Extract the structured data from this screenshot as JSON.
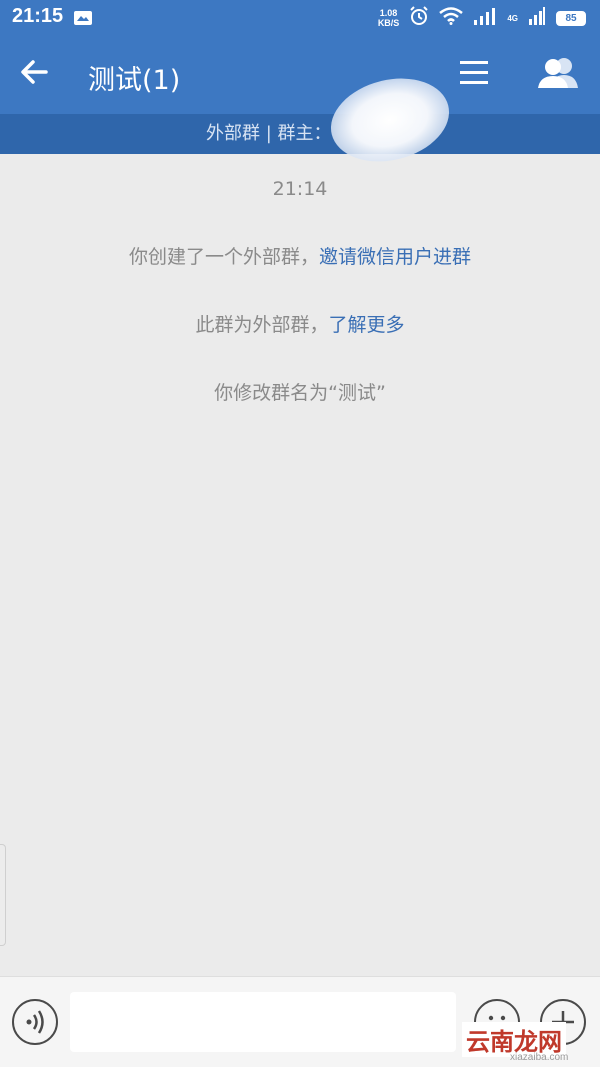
{
  "status_bar": {
    "time": "21:15",
    "net_speed_value": "1.08",
    "net_speed_unit": "KB/S",
    "network_type": "4G",
    "battery": "85"
  },
  "header": {
    "title": "测试(1)"
  },
  "group_info": {
    "text": "外部群 | 群主："
  },
  "chat": {
    "timestamp": "21:14",
    "messages": [
      {
        "text": "你创建了一个外部群，",
        "link": "邀请微信用户进群"
      },
      {
        "text": "此群为外部群，",
        "link": "了解更多"
      },
      {
        "text": "你修改群名为“测试”",
        "link": ""
      }
    ]
  },
  "input_bar": {
    "placeholder": ""
  },
  "watermark": {
    "brand": "云南龙网",
    "url": "xiazaiba.com"
  },
  "colors": {
    "header_blue": "#3d78c2",
    "subbar_blue": "#2f66ab",
    "link_blue": "#3a6fb5"
  }
}
